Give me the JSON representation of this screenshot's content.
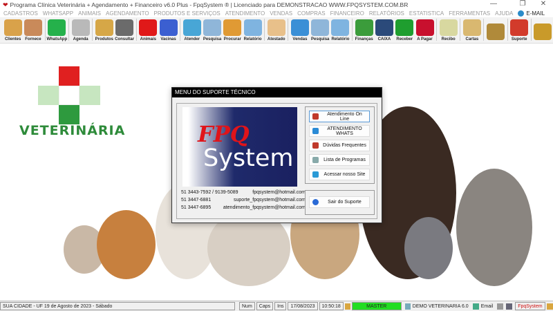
{
  "window": {
    "title": "Programa Clínica Veterinária + Agendamento + Financeiro v6.0 Plus - FpqSystem ® | Licenciado para  DEMONSTRACAO WWW.FPQSYSTEM.COM.BR",
    "minimize": "—",
    "maximize": "❐",
    "close": "✕"
  },
  "menu": [
    "CADASTROS",
    "WHATSAPP",
    "ANIMAIS",
    "AGENDAMENTO",
    "PRODUTOS E SERVIÇOS",
    "ATENDIMENTO",
    "VENDAS",
    "COMPRAS",
    "FINANCEIRO",
    "RELATÓRIOS",
    "ESTATISTICA",
    "FERRAMENTAS",
    "AJUDA"
  ],
  "menu_email": "E-MAIL",
  "toolbar": [
    {
      "label": "Clientes",
      "icon": "clients-icon",
      "color": "#d9a24a"
    },
    {
      "label": "Fornece",
      "icon": "supplier-icon",
      "color": "#c98a5a"
    },
    {
      "label": "WhatsApp",
      "icon": "whatsapp-icon",
      "color": "#25b14b"
    },
    {
      "label": "Agenda",
      "icon": "calendar-icon",
      "color": "#b9b9b9"
    },
    {
      "label": "Produtos",
      "icon": "boxes-icon",
      "color": "#d6a747"
    },
    {
      "label": "Consultar",
      "icon": "barcode-icon",
      "color": "#6b6b6b"
    },
    {
      "label": "Animais",
      "icon": "paw-icon",
      "color": "#e01919"
    },
    {
      "label": "Vacinas",
      "icon": "syringe-icon",
      "color": "#3b5fd1"
    },
    {
      "label": "Atender",
      "icon": "paw-plus-icon",
      "color": "#48a6d6"
    },
    {
      "label": "Pesquisa",
      "icon": "search-docs-icon",
      "color": "#8fb6d9"
    },
    {
      "label": "Procurar",
      "icon": "folder-icon",
      "color": "#e09a34"
    },
    {
      "label": "Relatório",
      "icon": "printer-icon",
      "color": "#7fb4e0"
    },
    {
      "label": "Atestado",
      "icon": "certificate-icon",
      "color": "#e8c08a"
    },
    {
      "label": "Vendas",
      "icon": "monitor-icon",
      "color": "#3a8fd6"
    },
    {
      "label": "Pesquisa",
      "icon": "search-docs-icon",
      "color": "#8fb6d9"
    },
    {
      "label": "Relatório",
      "icon": "printer-icon",
      "color": "#7fb4e0"
    },
    {
      "label": "Finanças",
      "icon": "finance-icon",
      "color": "#3b9c3b"
    },
    {
      "label": "CAIXA",
      "icon": "cashbook-icon",
      "color": "#2b4a7a"
    },
    {
      "label": "Receber",
      "icon": "receive-dollar-icon",
      "color": "#1f9e2f"
    },
    {
      "label": "A Pagar",
      "icon": "pay-dollar-icon",
      "color": "#c8102e"
    },
    {
      "label": "Recibo",
      "icon": "receipt-icon",
      "color": "#d8d8a0"
    },
    {
      "label": "Cartas",
      "icon": "scroll-icon",
      "color": "#d9b870"
    },
    {
      "label": "",
      "icon": "coin-icon",
      "color": "#b08a3a"
    },
    {
      "label": "Suporte",
      "icon": "support-icon",
      "color": "#d23b2b"
    },
    {
      "label": "",
      "icon": "exit-door-icon",
      "color": "#c99a2a"
    }
  ],
  "logo": {
    "text": "VETERINÁRIA"
  },
  "dialog": {
    "title": "MENU DO SUPORTE TÉCNICO",
    "banner": {
      "line1": "FPQ",
      "line2": "System"
    },
    "contacts": [
      {
        "phone": "51 3443-7592 / 9139-5089",
        "email": "fpqsystem@hotmail.com"
      },
      {
        "phone": "51 3447-6881",
        "email": "suporte_fpqsystem@hotmail.com"
      },
      {
        "phone": "51 3447-6895",
        "email": "atendimento_fpqsystem@hotmail.com"
      }
    ],
    "buttons": [
      {
        "label": "Atendimento On Line",
        "icon": "support-agent-icon",
        "color": "#c0392b"
      },
      {
        "label": "ATENDIMENTO WHATS",
        "icon": "chat-bubble-icon",
        "color": "#2a8bd6"
      },
      {
        "label": "Dúvidas Frequentes",
        "icon": "support-agent-icon",
        "color": "#c0392b"
      },
      {
        "label": "Lista de Programas",
        "icon": "program-list-icon",
        "color": "#8aa"
      },
      {
        "label": "Acessar nosso Site",
        "icon": "globe-arrow-icon",
        "color": "#2a9ad6"
      }
    ],
    "exit": "Sair do Suporte"
  },
  "status": {
    "location": "SUA CIDADE - UF 19 de Agosto de 2023 - Sábado",
    "num": "Num",
    "caps": "Caps",
    "ins": "Ins",
    "date": "17/08/2023",
    "time": "10:50:18",
    "user": "MASTER",
    "company": "DEMO VETERINARIA 6.0",
    "email": "Email",
    "brand": "FpqSystem"
  }
}
